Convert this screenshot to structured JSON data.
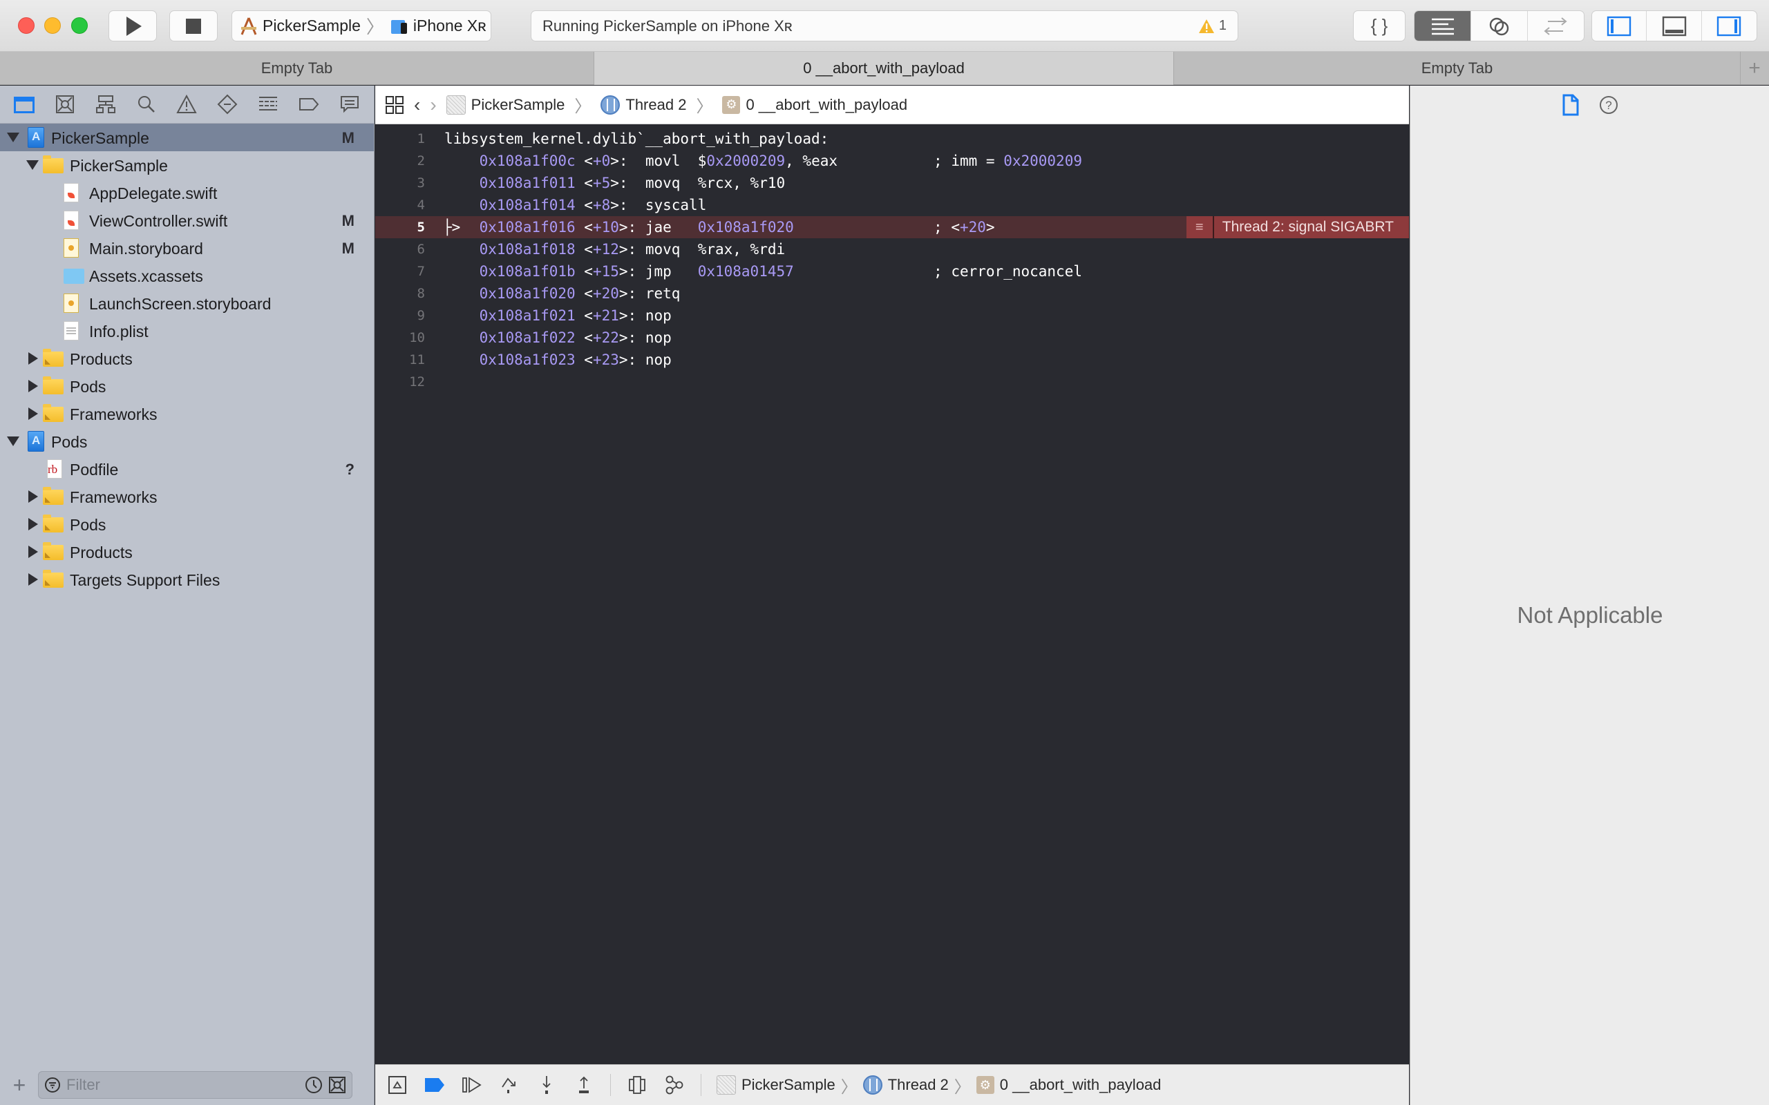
{
  "toolbar": {
    "scheme": {
      "project": "PickerSample",
      "device": "iPhone Xʀ"
    },
    "activity": {
      "status": "Running PickerSample on iPhone Xʀ",
      "warning_count": "1"
    },
    "icons": {
      "run": "play-icon",
      "stop": "stop-icon",
      "library": "braces-icon",
      "standard_editor": "lines-icon",
      "assistant_editor": "rings-icon",
      "version_editor": "arrows-icon",
      "navigator_toggle": "left-panel-icon",
      "debug_toggle": "bottom-panel-icon",
      "inspector_toggle": "right-panel-icon"
    }
  },
  "tabs": [
    {
      "label": "Empty Tab",
      "active": false
    },
    {
      "label": "0 __abort_with_payload",
      "active": true
    },
    {
      "label": "Empty Tab",
      "active": false
    }
  ],
  "navigator": {
    "icons": [
      "folder-icon",
      "source-control-icon",
      "hierarchy-icon",
      "search-icon",
      "warning-icon",
      "test-icon",
      "debug-icon",
      "breakpoint-icon",
      "report-icon"
    ],
    "tree": [
      {
        "label": "PickerSample",
        "type": "project",
        "level": 0,
        "disclosure": "open",
        "badge": "M",
        "selected": true
      },
      {
        "label": "PickerSample",
        "type": "folder",
        "level": 1,
        "disclosure": "open",
        "badge": ""
      },
      {
        "label": "AppDelegate.swift",
        "type": "swift",
        "level": 2,
        "disclosure": "",
        "badge": ""
      },
      {
        "label": "ViewController.swift",
        "type": "swift",
        "level": 2,
        "disclosure": "",
        "badge": "M"
      },
      {
        "label": "Main.storyboard",
        "type": "storyboard",
        "level": 2,
        "disclosure": "",
        "badge": "M"
      },
      {
        "label": "Assets.xcassets",
        "type": "assets",
        "level": 2,
        "disclosure": "",
        "badge": ""
      },
      {
        "label": "LaunchScreen.storyboard",
        "type": "storyboard",
        "level": 2,
        "disclosure": "",
        "badge": ""
      },
      {
        "label": "Info.plist",
        "type": "plist",
        "level": 2,
        "disclosure": "",
        "badge": ""
      },
      {
        "label": "Products",
        "type": "sysfolder",
        "level": 1,
        "disclosure": "closed",
        "badge": ""
      },
      {
        "label": "Pods",
        "type": "folder",
        "level": 1,
        "disclosure": "closed",
        "badge": ""
      },
      {
        "label": "Frameworks",
        "type": "sysfolder",
        "level": 1,
        "disclosure": "closed",
        "badge": ""
      },
      {
        "label": "Pods",
        "type": "project",
        "level": 0,
        "disclosure": "open",
        "badge": ""
      },
      {
        "label": "Podfile",
        "type": "ruby",
        "level": 1,
        "disclosure": "",
        "badge": "?"
      },
      {
        "label": "Frameworks",
        "type": "sysfolder",
        "level": 1,
        "disclosure": "closed",
        "badge": ""
      },
      {
        "label": "Pods",
        "type": "sysfolder",
        "level": 1,
        "disclosure": "closed",
        "badge": ""
      },
      {
        "label": "Products",
        "type": "sysfolder",
        "level": 1,
        "disclosure": "closed",
        "badge": ""
      },
      {
        "label": "Targets Support Files",
        "type": "sysfolder",
        "level": 1,
        "disclosure": "closed",
        "badge": ""
      }
    ],
    "filter": {
      "placeholder": "Filter",
      "value": ""
    }
  },
  "jumpbar": {
    "crumbs": [
      "PickerSample",
      "Thread 2",
      "0 __abort_with_payload"
    ]
  },
  "editor": {
    "current_line": 5,
    "lines": [
      {
        "n": "1",
        "header": "libsystem_kernel.dylib`__abort_with_payload:"
      },
      {
        "n": "2",
        "addr": "0x108a1f00c",
        "off": "+0",
        "instr": "movl",
        "ops_pre": "$",
        "ops_hex": "0x2000209",
        "ops_post": ", %eax",
        "comment_pre": "; imm = ",
        "comment_hex": "0x2000209"
      },
      {
        "n": "3",
        "addr": "0x108a1f011",
        "off": "+5",
        "instr": "movq",
        "ops_post": "%rcx, %r10"
      },
      {
        "n": "4",
        "addr": "0x108a1f014",
        "off": "+8",
        "instr": "syscall"
      },
      {
        "n": "5",
        "addr": "0x108a1f016",
        "off": "+10",
        "instr": "jae",
        "ops_hex": "0x108a1f020",
        "comment_pre": "; <",
        "comment_hex": "+20",
        "comment_post": ">"
      },
      {
        "n": "6",
        "addr": "0x108a1f018",
        "off": "+12",
        "instr": "movq",
        "ops_post": "%rax, %rdi"
      },
      {
        "n": "7",
        "addr": "0x108a1f01b",
        "off": "+15",
        "instr": "jmp",
        "ops_hex": "0x108a01457",
        "comment_pre": "; cerror_nocancel"
      },
      {
        "n": "8",
        "addr": "0x108a1f020",
        "off": "+20",
        "instr": "retq"
      },
      {
        "n": "9",
        "addr": "0x108a1f021",
        "off": "+21",
        "instr": "nop"
      },
      {
        "n": "10",
        "addr": "0x108a1f022",
        "off": "+22",
        "instr": "nop"
      },
      {
        "n": "11",
        "addr": "0x108a1f023",
        "off": "+23",
        "instr": "nop"
      },
      {
        "n": "12"
      }
    ],
    "pc_marker": "├>",
    "error_annotation": {
      "icon": "≡",
      "message": "Thread 2: signal SIGABRT"
    }
  },
  "debugbar": {
    "icons": [
      "hide-debug-area-icon",
      "breakpoints-active-icon",
      "continue-icon",
      "step-over-icon",
      "step-into-icon",
      "step-out-icon",
      "view-hierarchy-icon",
      "memory-graph-icon"
    ],
    "crumbs": [
      "PickerSample",
      "Thread 2",
      "0 __abort_with_payload"
    ]
  },
  "inspector": {
    "icons": [
      "file-inspector-icon",
      "quick-help-icon"
    ],
    "empty_message": "Not Applicable"
  },
  "colors": {
    "accent": "#1a7cf0",
    "error_line": "#4f2f33",
    "error_annotation": "#8d3a3c",
    "editor_bg": "#292a30",
    "address": "#a99af5"
  }
}
